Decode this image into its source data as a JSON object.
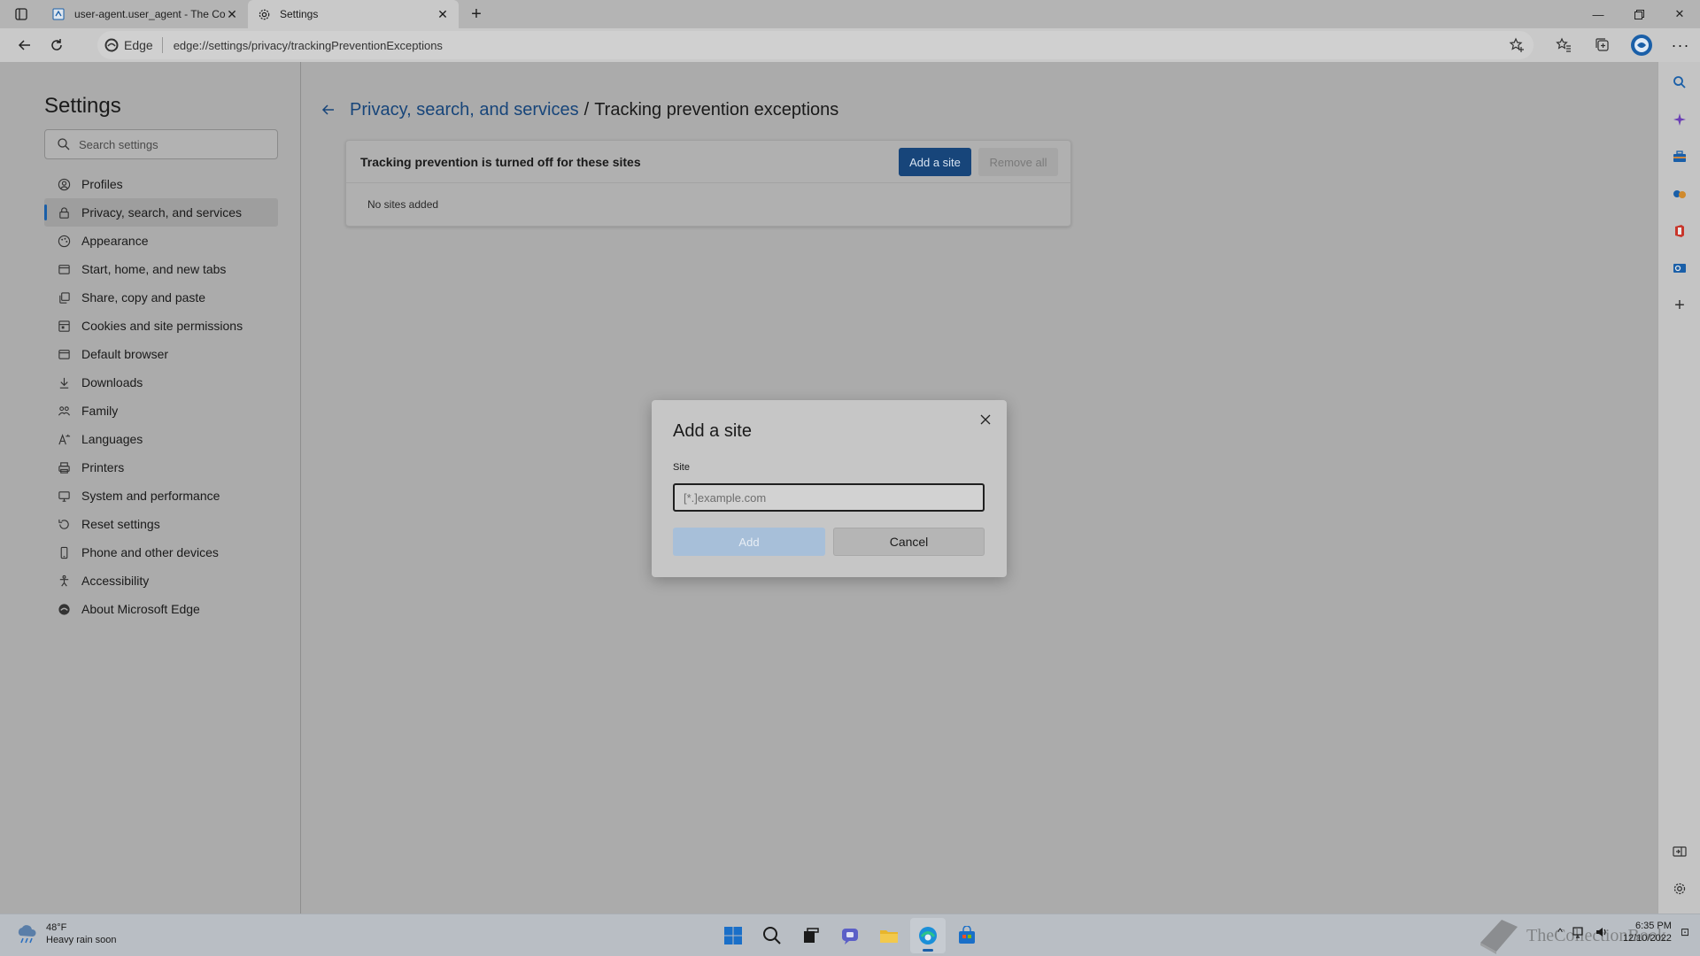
{
  "tabs": [
    {
      "title": "user-agent.user_agent - The Coll",
      "icon": "document-icon",
      "active": false
    },
    {
      "title": "Settings",
      "icon": "gear-icon",
      "active": true
    }
  ],
  "toolbar": {
    "brand": "Edge",
    "url": "edge://settings/privacy/trackingPreventionExceptions"
  },
  "settings": {
    "title": "Settings",
    "search_placeholder": "Search settings",
    "nav": [
      {
        "label": "Profiles",
        "icon": "profile-icon"
      },
      {
        "label": "Privacy, search, and services",
        "icon": "lock-icon",
        "selected": true
      },
      {
        "label": "Appearance",
        "icon": "appearance-icon"
      },
      {
        "label": "Start, home, and new tabs",
        "icon": "home-icon"
      },
      {
        "label": "Share, copy and paste",
        "icon": "share-icon"
      },
      {
        "label": "Cookies and site permissions",
        "icon": "cookies-icon"
      },
      {
        "label": "Default browser",
        "icon": "browser-icon"
      },
      {
        "label": "Downloads",
        "icon": "download-icon"
      },
      {
        "label": "Family",
        "icon": "family-icon"
      },
      {
        "label": "Languages",
        "icon": "languages-icon"
      },
      {
        "label": "Printers",
        "icon": "printer-icon"
      },
      {
        "label": "System and performance",
        "icon": "system-icon"
      },
      {
        "label": "Reset settings",
        "icon": "reset-icon"
      },
      {
        "label": "Phone and other devices",
        "icon": "phone-icon"
      },
      {
        "label": "Accessibility",
        "icon": "accessibility-icon"
      },
      {
        "label": "About Microsoft Edge",
        "icon": "edge-icon"
      }
    ]
  },
  "main": {
    "breadcrumb_parent": "Privacy, search, and services",
    "breadcrumb_separator": "/",
    "breadcrumb_current": "Tracking prevention exceptions",
    "card_heading": "Tracking prevention is turned off for these sites",
    "add_site_label": "Add a site",
    "remove_all_label": "Remove all",
    "empty_text": "No sites added"
  },
  "dialog": {
    "title": "Add a site",
    "field_label": "Site",
    "field_value": "",
    "field_placeholder": "[*.]example.com",
    "add_label": "Add",
    "cancel_label": "Cancel"
  },
  "taskbar": {
    "weather_temp": "48°F",
    "weather_desc": "Heavy rain soon",
    "time": "6:35 PM",
    "date": "12/10/2022",
    "watermark": "TheCollectionBook"
  },
  "colors": {
    "accent": "#17457a",
    "add_disabled": "#a7bfd9",
    "overlay_bg": "#ababab"
  }
}
